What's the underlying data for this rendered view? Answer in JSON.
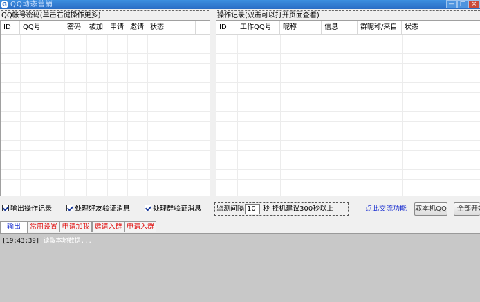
{
  "window": {
    "title": "QQ动态营销",
    "app_icon_glyph": "G",
    "buttons": {
      "minimize": "—",
      "maximize": "□",
      "close": "×"
    }
  },
  "left_panel": {
    "title": "QQ帐号密码(单击右键操作更多)",
    "columns": [
      "ID",
      "QQ号",
      "密码",
      "被加",
      "申请",
      "邀请",
      "状态"
    ]
  },
  "right_panel": {
    "title": "操作记录(双击可以打开页面查看)",
    "columns": [
      "ID",
      "工作QQ号",
      "昵称",
      "信息",
      "群昵称/来自",
      "状态"
    ]
  },
  "options": {
    "output_log": "输出操作记录",
    "friend_verify": "处理好友验证消息",
    "group_verify": "处理群验证消息"
  },
  "monitor": {
    "label": "监测间隔",
    "value": "10",
    "unit": "秒 挂机建议300秒以上"
  },
  "link": {
    "exchange": "点此交流功能"
  },
  "buttons": {
    "get_local_qq": "取本机QQ",
    "start_all": "全部开始"
  },
  "tabs": [
    "输出",
    "常用设置",
    "申请加我",
    "邀请入群",
    "申请入群"
  ],
  "output_log": [
    {
      "time": "[19:43:39]",
      "message": "读取本地数据..."
    }
  ],
  "colors": {
    "titlebar": "#2a6cc4",
    "tab_red": "#e01010",
    "link_blue": "#1a2fd0",
    "output_bg": "#c8c8c8"
  }
}
